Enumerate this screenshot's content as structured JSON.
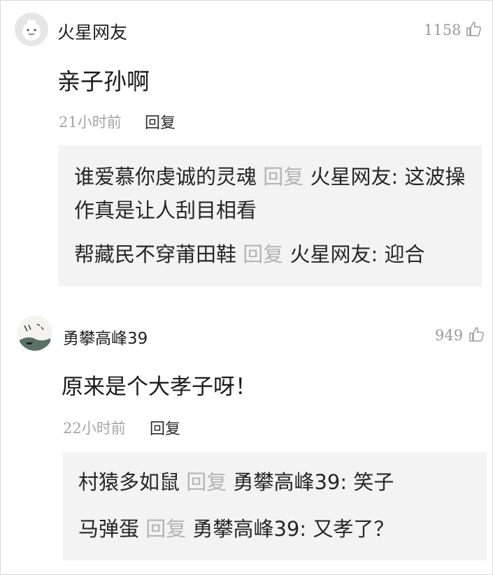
{
  "comments": [
    {
      "username": "火星网友",
      "likes": "1158",
      "text": "亲子孙啊",
      "time": "21小时前",
      "reply_label": "回复",
      "replies": [
        {
          "author": "谁爱慕你虔诚的灵魂",
          "verb": "回复",
          "target": "火星网友:",
          "text": "这波操作真是让人刮目相看"
        },
        {
          "author": "帮藏民不穿莆田鞋",
          "verb": "回复",
          "target": "火星网友:",
          "text": "迎合"
        }
      ]
    },
    {
      "username": "勇攀高峰39",
      "likes": "949",
      "text": "原来是个大孝子呀！",
      "time": "22小时前",
      "reply_label": "回复",
      "replies": [
        {
          "author": "村猿多如鼠",
          "verb": "回复",
          "target": "勇攀高峰39:",
          "text": "笑子"
        },
        {
          "author": "马弹蛋",
          "verb": "回复",
          "target": "勇攀高峰39:",
          "text": "又孝了？"
        }
      ]
    }
  ],
  "icons": {
    "like": "thumbs-up-icon",
    "avatar1": "default-avatar-icon",
    "avatar2": "ink-painting-avatar"
  }
}
